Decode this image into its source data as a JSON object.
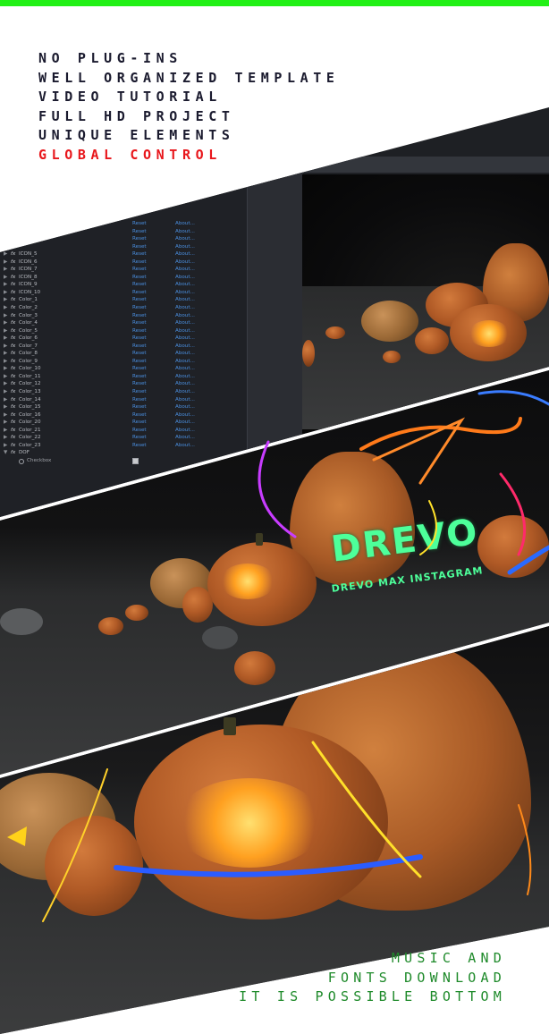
{
  "features": [
    {
      "text": "NO PLUG-INS",
      "accent": false
    },
    {
      "text": "WELL ORGANIZED TEMPLATE",
      "accent": false
    },
    {
      "text": "VIDEO TUTORIAL",
      "accent": false
    },
    {
      "text": "FULL HD PROJECT",
      "accent": false
    },
    {
      "text": "UNIQUE ELEMENTS",
      "accent": false
    },
    {
      "text": "GLOBAL CONTROL",
      "accent": true
    }
  ],
  "editor": {
    "reset_label": "Reset",
    "about_label": "About...",
    "effects": [
      "",
      "",
      "",
      "",
      "ICON_5",
      "ICON_6",
      "ICON_7",
      "ICON_8",
      "ICON_9",
      "ICON_10",
      "Color_1",
      "Color_2",
      "Color_3",
      "Color_4",
      "Color_5",
      "Color_6",
      "Color_7",
      "Color_8",
      "Color_9",
      "Color_10",
      "Color_11",
      "Color_12",
      "Color_13",
      "Color_14",
      "Color_15",
      "Color_16",
      "Color_20",
      "Color_21",
      "Color_22",
      "Color_23",
      "DOF"
    ],
    "checkbox_label": "Checkbox"
  },
  "logo": {
    "title": "DREVO",
    "subtitle": "DREVO MAX INSTAGRAM"
  },
  "footer": [
    "MUSIC AND",
    "FONTS DOWNLOAD",
    "IT IS POSSIBLE BOTTOM"
  ],
  "colors": {
    "top_bar": "#22f016",
    "feature_text": "#1a1a2e",
    "accent": "#e8161b",
    "footer_text": "#1e8a2a",
    "logo_green": "#4dff9a"
  }
}
